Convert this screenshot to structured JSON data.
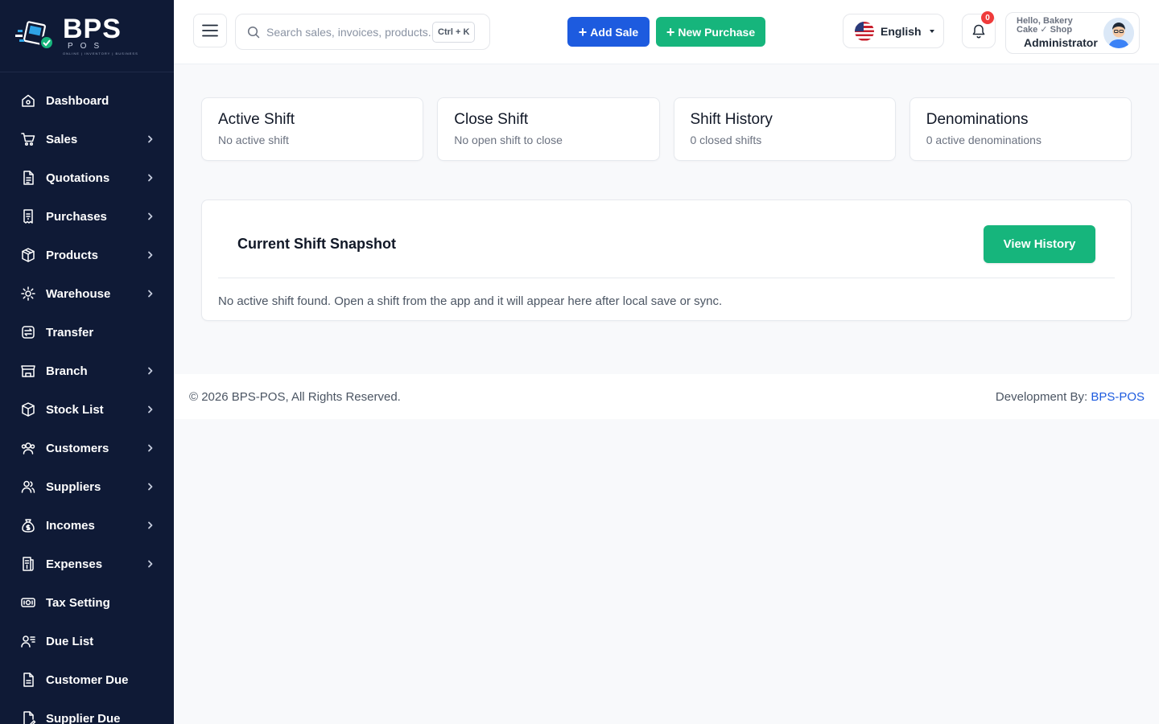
{
  "brand": {
    "name": "BPS",
    "sub": "POS",
    "tagline": "ONLINE | INVENTORY | BUSINESS"
  },
  "sidebar": {
    "items": [
      {
        "label": "Dashboard",
        "icon": "home-icon",
        "chevron": false
      },
      {
        "label": "Sales",
        "icon": "cart-icon",
        "chevron": true
      },
      {
        "label": "Quotations",
        "icon": "document-icon",
        "chevron": true
      },
      {
        "label": "Purchases",
        "icon": "receipt-icon",
        "chevron": true
      },
      {
        "label": "Products",
        "icon": "box-icon",
        "chevron": true
      },
      {
        "label": "Warehouse",
        "icon": "warehouse-gear-icon",
        "chevron": true
      },
      {
        "label": "Transfer",
        "icon": "transfer-icon",
        "chevron": false
      },
      {
        "label": "Branch",
        "icon": "store-icon",
        "chevron": true
      },
      {
        "label": "Stock List",
        "icon": "cube-icon",
        "chevron": true
      },
      {
        "label": "Customers",
        "icon": "users-icon",
        "chevron": true
      },
      {
        "label": "Suppliers",
        "icon": "user-group-icon",
        "chevron": true
      },
      {
        "label": "Incomes",
        "icon": "money-bag-icon",
        "chevron": true
      },
      {
        "label": "Expenses",
        "icon": "bill-icon",
        "chevron": true
      },
      {
        "label": "Tax Setting",
        "icon": "cash-icon",
        "chevron": false
      },
      {
        "label": "Due List",
        "icon": "user-list-icon",
        "chevron": false
      },
      {
        "label": "Customer Due",
        "icon": "file-icon",
        "chevron": false
      },
      {
        "label": "Supplier Due",
        "icon": "file-edit-icon",
        "chevron": false
      }
    ]
  },
  "header": {
    "search_placeholder": "Search sales, invoices, products...",
    "shortcut": "Ctrl + K",
    "add_sale": "Add Sale",
    "new_purchase": "New Purchase",
    "language": "English",
    "notification_count": "0",
    "greeting": "Hello, Bakery Cake ✓ Shop",
    "role": "Administrator"
  },
  "cards": [
    {
      "title": "Active Shift",
      "sub": "No active shift"
    },
    {
      "title": "Close Shift",
      "sub": "No open shift to close"
    },
    {
      "title": "Shift History",
      "sub": "0 closed shifts"
    },
    {
      "title": "Denominations",
      "sub": "0 active denominations"
    }
  ],
  "snapshot": {
    "title": "Current Shift Snapshot",
    "button": "View History",
    "message": "No active shift found. Open a shift from the app and it will appear here after local save or sync."
  },
  "footer": {
    "copyright": "© 2026 BPS-POS, All Rights Reserved.",
    "dev_prefix": "Development By: ",
    "dev_link": "BPS-POS"
  },
  "colors": {
    "sidebar": "#0f1a36",
    "primary": "#1d5bdf",
    "success": "#16b57c",
    "badge": "#ef3b3b"
  }
}
